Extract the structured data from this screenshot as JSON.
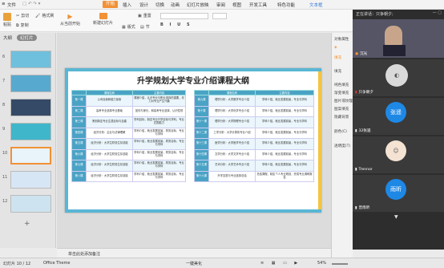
{
  "menubar": {
    "file": "文件",
    "items": [
      "开始",
      "插入",
      "设计",
      "切换",
      "动画",
      "幻灯片放映",
      "审阅",
      "视图",
      "开发工具",
      "特色功能",
      "文本框"
    ],
    "active_index": 0
  },
  "ribbon": {
    "cut": "剪切",
    "copy": "复制",
    "format_painter": "格式刷",
    "paste": "粘贴",
    "from_start": "从当前开始",
    "new_slide": "新建幻灯片",
    "layout": "版式",
    "section": "节",
    "reset": "重置"
  },
  "thumbs": {
    "tab_outline": "大纲",
    "tab_slides": "幻灯片",
    "numbers": [
      "6",
      "7",
      "8",
      "9",
      "10",
      "11",
      "12"
    ],
    "selected": "10"
  },
  "slide": {
    "title": "升学规划大学专业介绍课程大纲",
    "left_table": {
      "headers": [
        "",
        "课程名称",
        "主要内容"
      ],
      "rows": [
        [
          "第一课",
          "公司自我和能力探索",
          "课程介绍，认识专业与职业选择的重要，尽力对专业产生兴趣"
        ],
        [
          "第二课",
          "高考专业选择专业基础",
          "如何与家长，和高考专业选择，认识性别"
        ],
        [
          "第三课",
          "策划制定专业生涯目标与自建",
          "学科目标，制定专业升学目标与学科，专业匹配能力"
        ],
        [
          "第四课",
          "经济分析：企业与法律理解",
          "学科介绍，就业发展前景，财务目标，专业与学科"
        ],
        [
          "第五课",
          "经济分析：大学生财务生存技能",
          "学科介绍，就业发展前景，财务目标，专业与学科"
        ],
        [
          "第六课",
          "经济分析：大学生财务生存技能",
          "学科介绍，就业发展前景，财务目标，专业与学科"
        ],
        [
          "第七课",
          "经济分析：大学生财务生存技能",
          "学科介绍，就业发展前景，财务目标，专业与学科"
        ],
        [
          "第八课",
          "经济分析：大学生财务生存技能",
          "学科介绍，就业发展前景，财务目标，专业与学科"
        ]
      ]
    },
    "right_table": {
      "headers": [
        "",
        "课程名称",
        "主要内容"
      ],
      "rows": [
        [
          "第九课",
          "理学分析：大学数学专业介绍",
          "学科介绍，就业发展前景，专业与学科"
        ],
        [
          "第十课",
          "理学分析：大学化学专业介绍",
          "学科介绍，就业发展前景，专业与学科"
        ],
        [
          "第十一课",
          "理学分析：大学物理专业介绍",
          "学科介绍，就业发展前景，专业与学科"
        ],
        [
          "第十二课",
          "工学分析：大学计算机专业介绍",
          "学科介绍，就业发展前景，专业与学科"
        ],
        [
          "第十三课",
          "医学分析：大学医学专业介绍",
          "学科介绍，就业发展前景，专业与学科"
        ],
        [
          "第十四课",
          "文学分析：大学文学专业介绍",
          "学科介绍，就业发展前景，专业与学科"
        ],
        [
          "第十五课",
          "艺术分析：大学艺术专业介绍",
          "学科介绍，就业发展前景，专业与学科"
        ],
        [
          "第十六课",
          "升学志愿与专业选择总结",
          "总结课程，制定个人专业规划，完成专业调研报告"
        ]
      ]
    }
  },
  "notes": {
    "placeholder": "单击此处添加备注"
  },
  "rightpane": {
    "items": [
      "对象属性",
      "填充",
      "线条",
      "填充",
      "纯色填充",
      "渐变填充",
      "图片或纹理",
      "图案填充",
      "隐藏背景",
      "颜色(C)",
      "透明度(T)"
    ]
  },
  "status": {
    "slide_counter": "幻灯片 10 / 12",
    "theme": "Office Theme",
    "beautify": "一键美化",
    "zoom": "54%"
  },
  "meeting": {
    "header": "正在讲话：只争朝夕;",
    "participants": [
      {
        "name": "沉光",
        "type": "video"
      },
      {
        "name": "只争朝夕",
        "type": "photo"
      },
      {
        "name": "32张遥",
        "avatar_text": "张遥",
        "type": "initials",
        "color": "#1e88e5"
      },
      {
        "name": "Trennor",
        "type": "photo"
      },
      {
        "name": "曾雨昕",
        "avatar_text": "雨昕",
        "type": "initials",
        "color": "#1e88e5"
      }
    ]
  },
  "colors": {
    "accent_orange": "#f29135",
    "slide_blue": "#59b6d4",
    "slide_yellow": "#f4c542"
  }
}
